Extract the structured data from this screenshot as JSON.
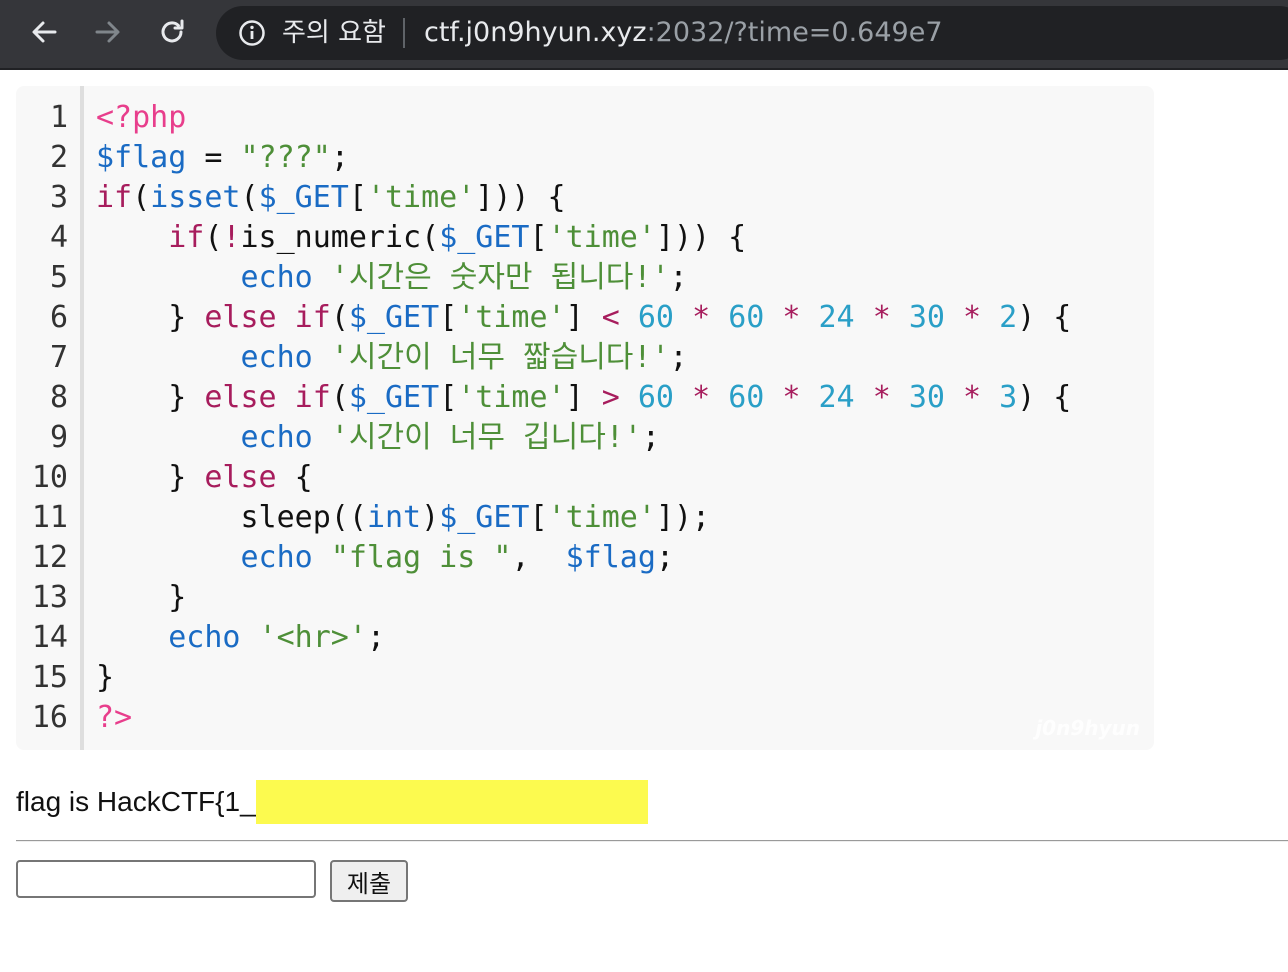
{
  "browser": {
    "security_label": "주의 요함",
    "url_host": "ctf.j0n9hyun.xyz",
    "url_rest": ":2032/?time=0.649e7",
    "icons": {
      "back": "back-arrow-icon",
      "forward": "forward-arrow-icon",
      "reload": "reload-icon",
      "info": "info-icon"
    }
  },
  "code": {
    "line_numbers": [
      "1",
      "2",
      "3",
      "4",
      "5",
      "6",
      "7",
      "8",
      "9",
      "10",
      "11",
      "12",
      "13",
      "14",
      "15",
      "16"
    ],
    "lines": [
      [
        [
          "php",
          "<?php"
        ]
      ],
      [
        [
          "var",
          "$flag"
        ],
        [
          "pl",
          " = "
        ],
        [
          "str",
          "\"???\""
        ],
        [
          "pl",
          ";"
        ]
      ],
      [
        [
          "kw",
          "if"
        ],
        [
          "pl",
          "("
        ],
        [
          "fn",
          "isset"
        ],
        [
          "pl",
          "("
        ],
        [
          "var",
          "$_GET"
        ],
        [
          "pl",
          "["
        ],
        [
          "str",
          "'time'"
        ],
        [
          "pl",
          "])) {"
        ]
      ],
      [
        [
          "pl",
          "    "
        ],
        [
          "kw",
          "if"
        ],
        [
          "pl",
          "("
        ],
        [
          "op",
          "!"
        ],
        [
          "pl",
          "is_numeric("
        ],
        [
          "var",
          "$_GET"
        ],
        [
          "pl",
          "["
        ],
        [
          "str",
          "'time'"
        ],
        [
          "pl",
          "])) {"
        ]
      ],
      [
        [
          "pl",
          "        "
        ],
        [
          "fn",
          "echo"
        ],
        [
          "pl",
          " "
        ],
        [
          "str",
          "'시간은 숫자만 됩니다!'"
        ],
        [
          "pl",
          ";"
        ]
      ],
      [
        [
          "pl",
          "    } "
        ],
        [
          "kw",
          "else if"
        ],
        [
          "pl",
          "("
        ],
        [
          "var",
          "$_GET"
        ],
        [
          "pl",
          "["
        ],
        [
          "str",
          "'time'"
        ],
        [
          "pl",
          "] "
        ],
        [
          "op",
          "<"
        ],
        [
          "pl",
          " "
        ],
        [
          "num",
          "60"
        ],
        [
          "pl",
          " "
        ],
        [
          "op",
          "*"
        ],
        [
          "pl",
          " "
        ],
        [
          "num",
          "60"
        ],
        [
          "pl",
          " "
        ],
        [
          "op",
          "*"
        ],
        [
          "pl",
          " "
        ],
        [
          "num",
          "24"
        ],
        [
          "pl",
          " "
        ],
        [
          "op",
          "*"
        ],
        [
          "pl",
          " "
        ],
        [
          "num",
          "30"
        ],
        [
          "pl",
          " "
        ],
        [
          "op",
          "*"
        ],
        [
          "pl",
          " "
        ],
        [
          "num",
          "2"
        ],
        [
          "pl",
          ") {"
        ]
      ],
      [
        [
          "pl",
          "        "
        ],
        [
          "fn",
          "echo"
        ],
        [
          "pl",
          " "
        ],
        [
          "str",
          "'시간이 너무 짧습니다!'"
        ],
        [
          "pl",
          ";"
        ]
      ],
      [
        [
          "pl",
          "    } "
        ],
        [
          "kw",
          "else if"
        ],
        [
          "pl",
          "("
        ],
        [
          "var",
          "$_GET"
        ],
        [
          "pl",
          "["
        ],
        [
          "str",
          "'time'"
        ],
        [
          "pl",
          "] "
        ],
        [
          "op",
          ">"
        ],
        [
          "pl",
          " "
        ],
        [
          "num",
          "60"
        ],
        [
          "pl",
          " "
        ],
        [
          "op",
          "*"
        ],
        [
          "pl",
          " "
        ],
        [
          "num",
          "60"
        ],
        [
          "pl",
          " "
        ],
        [
          "op",
          "*"
        ],
        [
          "pl",
          " "
        ],
        [
          "num",
          "24"
        ],
        [
          "pl",
          " "
        ],
        [
          "op",
          "*"
        ],
        [
          "pl",
          " "
        ],
        [
          "num",
          "30"
        ],
        [
          "pl",
          " "
        ],
        [
          "op",
          "*"
        ],
        [
          "pl",
          " "
        ],
        [
          "num",
          "3"
        ],
        [
          "pl",
          ") {"
        ]
      ],
      [
        [
          "pl",
          "        "
        ],
        [
          "fn",
          "echo"
        ],
        [
          "pl",
          " "
        ],
        [
          "str",
          "'시간이 너무 깁니다!'"
        ],
        [
          "pl",
          ";"
        ]
      ],
      [
        [
          "pl",
          "    } "
        ],
        [
          "kw",
          "else"
        ],
        [
          "pl",
          " {"
        ]
      ],
      [
        [
          "pl",
          "        sleep(("
        ],
        [
          "fn",
          "int"
        ],
        [
          "pl",
          ")"
        ],
        [
          "var",
          "$_GET"
        ],
        [
          "pl",
          "["
        ],
        [
          "str",
          "'time'"
        ],
        [
          "pl",
          "]);"
        ]
      ],
      [
        [
          "pl",
          "        "
        ],
        [
          "fn",
          "echo"
        ],
        [
          "pl",
          " "
        ],
        [
          "str",
          "\"flag is \""
        ],
        [
          "pl",
          ",  "
        ],
        [
          "var",
          "$flag"
        ],
        [
          "pl",
          ";"
        ]
      ],
      [
        [
          "pl",
          "    }"
        ]
      ],
      [
        [
          "pl",
          "    "
        ],
        [
          "fn",
          "echo"
        ],
        [
          "pl",
          " "
        ],
        [
          "str",
          "'<hr>'"
        ],
        [
          "pl",
          ";"
        ]
      ],
      [
        [
          "pl",
          "}"
        ]
      ],
      [
        [
          "php",
          "?>"
        ]
      ]
    ],
    "watermark": "j0n9hyun"
  },
  "output": {
    "flag_prefix": "flag is HackCTF{1_",
    "redaction_color": "#fcfa4f"
  },
  "form": {
    "input_value": "",
    "submit_label": "제출"
  }
}
